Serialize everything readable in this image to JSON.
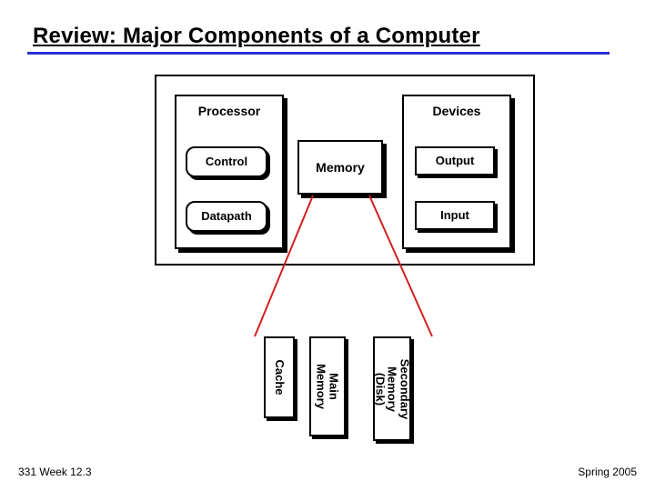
{
  "title": "Review:  Major Components of a Computer",
  "processor": {
    "label": "Processor",
    "control": "Control",
    "datapath": "Datapath"
  },
  "memory": "Memory",
  "devices": {
    "label": "Devices",
    "output": "Output",
    "input": "Input"
  },
  "tiers": {
    "cache": "Cache",
    "main_line1": "Main",
    "main_line2": "Memory",
    "secondary_line1": "Secondary",
    "secondary_line2": "Memory",
    "secondary_line3": "(Disk)"
  },
  "footer": {
    "left": "331 Week 12.3",
    "right": "Spring 2005"
  }
}
